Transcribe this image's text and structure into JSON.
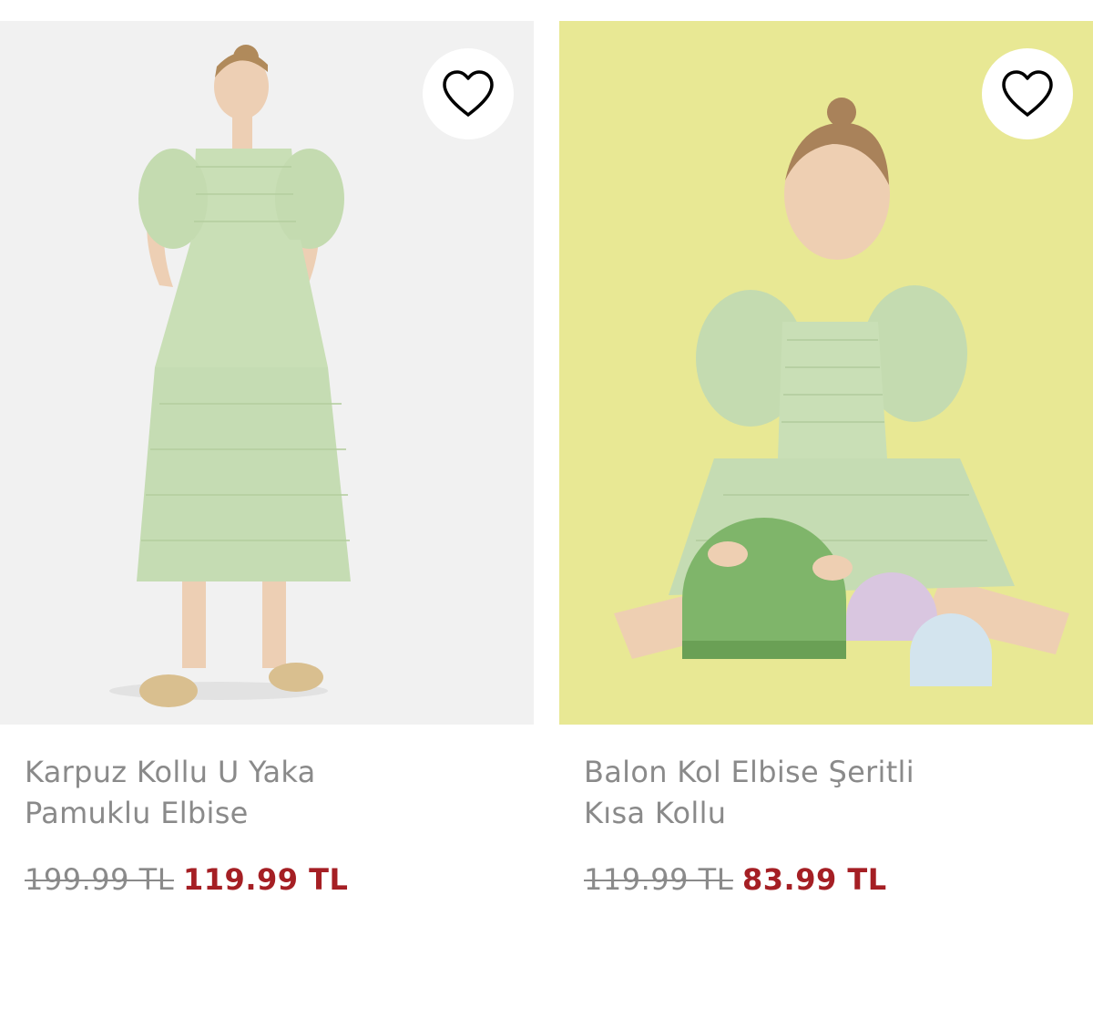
{
  "colors": {
    "title_text": "#8a8a8a",
    "old_price": "#8a8a8a",
    "sale_price": "#a51f24",
    "photo_bg_left": "#f1f1f1",
    "photo_bg_right": "#e8e894",
    "dress": "#c9dfb6"
  },
  "products": [
    {
      "image_alt": "woman-in-green-midi-dress",
      "favorite_icon": "heart-outline-icon",
      "title_line1": "Karpuz Kollu U Yaka",
      "title_line2": "Pamuklu Elbise",
      "old_price": "199.99 TL",
      "sale_price": "119.99 TL"
    },
    {
      "image_alt": "girl-in-green-puff-sleeve-dress-with-blocks",
      "favorite_icon": "heart-outline-icon",
      "title_line1": "Balon Kol Elbise Şeritli",
      "title_line2": "Kısa Kollu",
      "old_price": "119.99 TL",
      "sale_price": "83.99 TL"
    }
  ]
}
